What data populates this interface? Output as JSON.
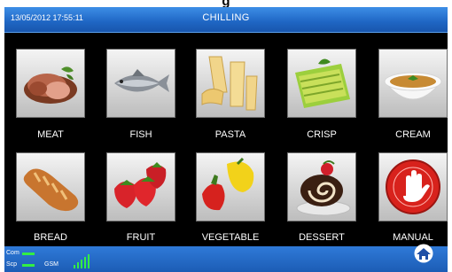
{
  "window_title": "g",
  "header": {
    "datetime": "13/05/2012 17:55:11",
    "title": "CHILLING"
  },
  "tiles": [
    {
      "label": "MEAT",
      "icon": "meat-icon"
    },
    {
      "label": "FISH",
      "icon": "fish-icon"
    },
    {
      "label": "PASTA",
      "icon": "pasta-icon"
    },
    {
      "label": "CRISP",
      "icon": "crisp-icon"
    },
    {
      "label": "CREAM",
      "icon": "cream-icon"
    },
    {
      "label": "BREAD",
      "icon": "bread-icon"
    },
    {
      "label": "FRUIT",
      "icon": "fruit-icon"
    },
    {
      "label": "VEGETABLE",
      "icon": "vegetable-icon"
    },
    {
      "label": "DESSERT",
      "icon": "dessert-icon"
    },
    {
      "label": "MANUAL",
      "icon": "manual-hand-icon"
    }
  ],
  "status": {
    "com_label": "Com",
    "scp_label": "Scp",
    "gsm_label": "GSM"
  },
  "colors": {
    "header": "#1f66c4",
    "status_ok": "#33ee44",
    "manual_red": "#d8221c"
  },
  "home_icon": "home-icon"
}
